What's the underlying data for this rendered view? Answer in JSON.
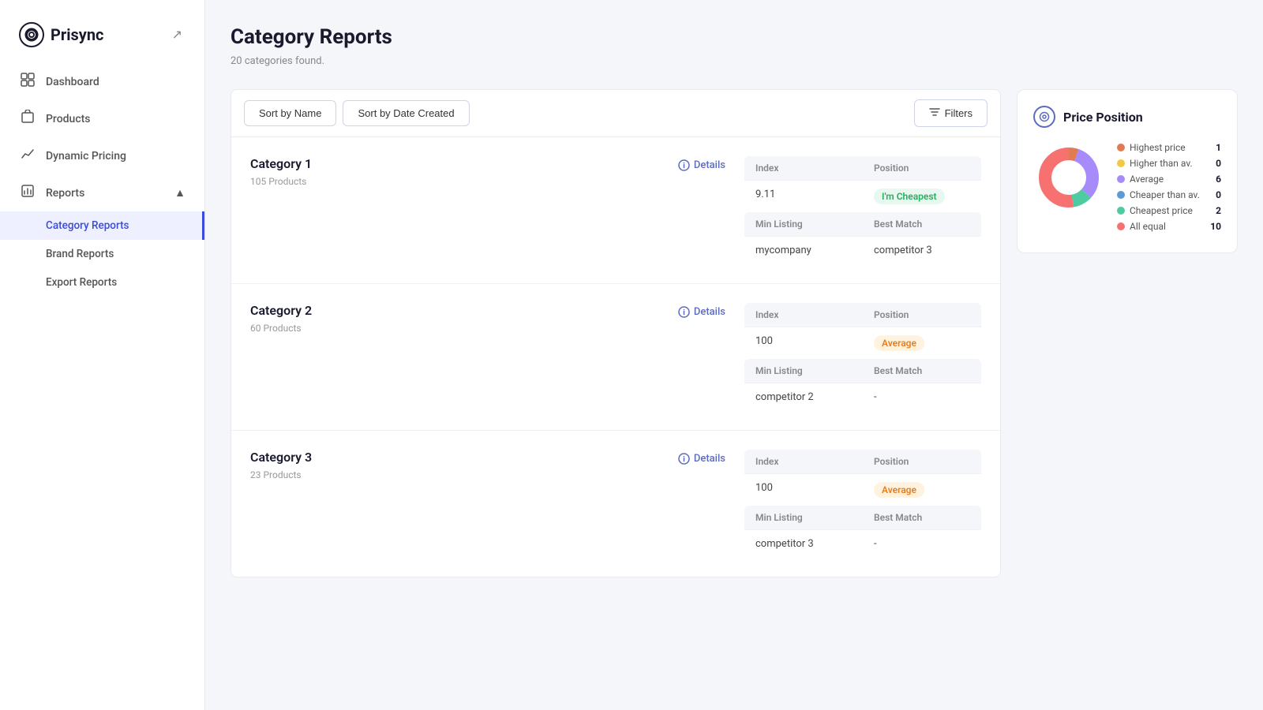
{
  "app": {
    "name": "Prisync"
  },
  "sidebar": {
    "collapse_label": "↗",
    "nav_items": [
      {
        "id": "dashboard",
        "label": "Dashboard",
        "icon": "⊞"
      },
      {
        "id": "products",
        "label": "Products",
        "icon": "📦"
      },
      {
        "id": "dynamic-pricing",
        "label": "Dynamic Pricing",
        "icon": "↗"
      },
      {
        "id": "reports",
        "label": "Reports",
        "icon": "📊",
        "has_caret": true,
        "expanded": true
      }
    ],
    "sub_nav_items": [
      {
        "id": "category-reports",
        "label": "Category Reports",
        "active": true
      },
      {
        "id": "brand-reports",
        "label": "Brand Reports",
        "active": false
      },
      {
        "id": "export-reports",
        "label": "Export Reports",
        "active": false
      }
    ]
  },
  "page": {
    "title": "Category Reports",
    "subtitle": "20 categories found."
  },
  "toolbar": {
    "sort_by_name": "Sort by Name",
    "sort_by_date": "Sort by Date Created",
    "filters": "Filters"
  },
  "categories": [
    {
      "name": "Category 1",
      "count": "105 Products",
      "details_label": "Details",
      "index": "9.11",
      "position": "I'm Cheapest",
      "position_type": "green",
      "min_listing": "mycompany",
      "best_match": "competitor 3"
    },
    {
      "name": "Category 2",
      "count": "60 Products",
      "details_label": "Details",
      "index": "100",
      "position": "Average",
      "position_type": "orange",
      "min_listing": "competitor 2",
      "best_match": "-"
    },
    {
      "name": "Category 3",
      "count": "23 Products",
      "details_label": "Details",
      "index": "100",
      "position": "Average",
      "position_type": "orange",
      "min_listing": "competitor 3",
      "best_match": "-"
    }
  ],
  "table_headers": {
    "index": "Index",
    "position": "Position",
    "min_listing": "Min Listing",
    "best_match": "Best Match"
  },
  "price_position": {
    "title": "Price Position",
    "legend": [
      {
        "id": "highest",
        "label": "Highest price",
        "value": "1",
        "color": "#e07b54"
      },
      {
        "id": "higher-than-av",
        "label": "Higher than av.",
        "value": "0",
        "color": "#f5c842"
      },
      {
        "id": "average",
        "label": "Average",
        "value": "6",
        "color": "#a78bfa"
      },
      {
        "id": "cheaper-than-av",
        "label": "Cheaper than av.",
        "value": "0",
        "color": "#5b9bd5"
      },
      {
        "id": "cheapest",
        "label": "Cheapest price",
        "value": "2",
        "color": "#4ecba0"
      },
      {
        "id": "all-equal",
        "label": "All equal",
        "value": "10",
        "color": "#f87171"
      }
    ],
    "donut": {
      "segments": [
        {
          "label": "Highest price",
          "value": 1,
          "color": "#e07b54"
        },
        {
          "label": "Average",
          "value": 6,
          "color": "#a78bfa"
        },
        {
          "label": "Cheapest price",
          "value": 2,
          "color": "#4ecba0"
        },
        {
          "label": "All equal",
          "value": 10,
          "color": "#f87171"
        }
      ]
    }
  }
}
